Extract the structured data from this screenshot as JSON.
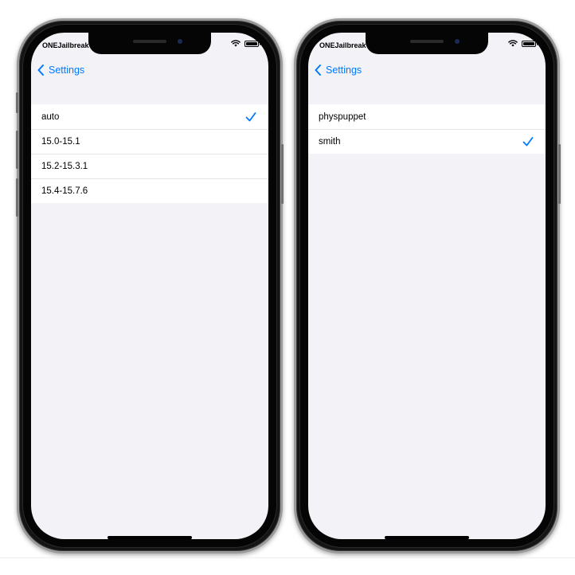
{
  "colors": {
    "accent": "#007aff",
    "screen_bg": "#f2f2f7",
    "bezel": "#141414"
  },
  "phones": [
    {
      "status": {
        "carrier": "ONEJailbreak",
        "icons": [
          "wifi-icon",
          "battery-icon"
        ]
      },
      "nav": {
        "back_label": "Settings",
        "back_icon": "chevron-left-icon"
      },
      "options": [
        {
          "label": "auto",
          "selected": true
        },
        {
          "label": "15.0-15.1",
          "selected": false
        },
        {
          "label": "15.2-15.3.1",
          "selected": false
        },
        {
          "label": "15.4-15.7.6",
          "selected": false
        }
      ]
    },
    {
      "status": {
        "carrier": "ONEJailbreak",
        "icons": [
          "wifi-icon",
          "battery-icon"
        ]
      },
      "nav": {
        "back_label": "Settings",
        "back_icon": "chevron-left-icon"
      },
      "options": [
        {
          "label": "physpuppet",
          "selected": false
        },
        {
          "label": "smith",
          "selected": true
        }
      ]
    }
  ]
}
